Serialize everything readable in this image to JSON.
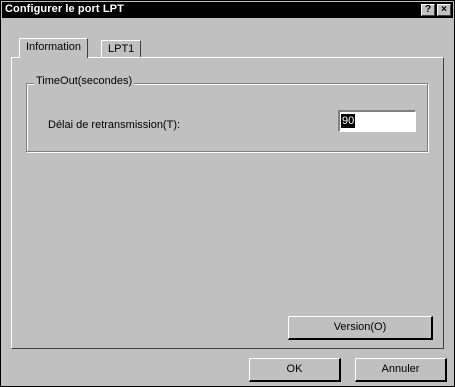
{
  "window": {
    "title": "Configurer le port LPT",
    "help_button": "?",
    "close_button": "×"
  },
  "tabs": [
    {
      "label": "Information",
      "active": true
    },
    {
      "label": "LPT1",
      "active": false
    }
  ],
  "group": {
    "legend": "TimeOut(secondes)",
    "field_label": "Délai de retransmission(T):",
    "field_value": "90"
  },
  "buttons": {
    "version": "Version(O)",
    "ok": "OK",
    "cancel": "Annuler"
  }
}
